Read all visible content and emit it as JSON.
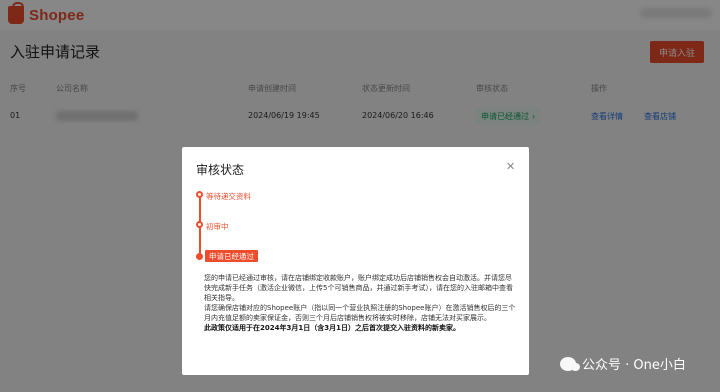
{
  "topbar": {
    "logo_text": "Shopee"
  },
  "page": {
    "title": "入驻申请记录",
    "apply_button": "申请入驻"
  },
  "table": {
    "headers": [
      "序号",
      "公司名称",
      "申请创建时间",
      "状态更新时间",
      "审核状态",
      "操作"
    ],
    "rows": [
      {
        "index": "01",
        "created": "2024/06/19 19:45",
        "updated": "2024/06/20 16:46",
        "status": "申请已经通过",
        "actions": [
          "查看详情",
          "查看店铺"
        ]
      }
    ]
  },
  "modal": {
    "title": "审核状态",
    "close_icon": "close-icon",
    "steps": [
      "等待递交资料",
      "初审中",
      "申请已经通过"
    ],
    "description": [
      "您的申请已经通过审核，请在店铺绑定收款账户，账户绑定成功后店铺销售权会自动激活。并请您尽快完成新手任务（激活企业微信，上传5个可销售商品，并通过新手考试），请在您的入驻邮箱中查看相关指导。",
      "请您确保店铺对应的Shopee账户（指以同一个营业执照注册的Shopee账户）在激活销售权后的三个月内充值足额的卖家保证金，否则三个月后店铺销售权将被实时移除，店铺无法对买家展示。",
      "此政策仅适用于在2024年3月1日（含3月1日）之后首次提交入驻资料的新卖家。"
    ]
  },
  "watermark": {
    "text": "公众号 · One小白"
  },
  "colors": {
    "brand": "#ee4d2d",
    "link": "#2673dd",
    "success": "#1aa260"
  }
}
